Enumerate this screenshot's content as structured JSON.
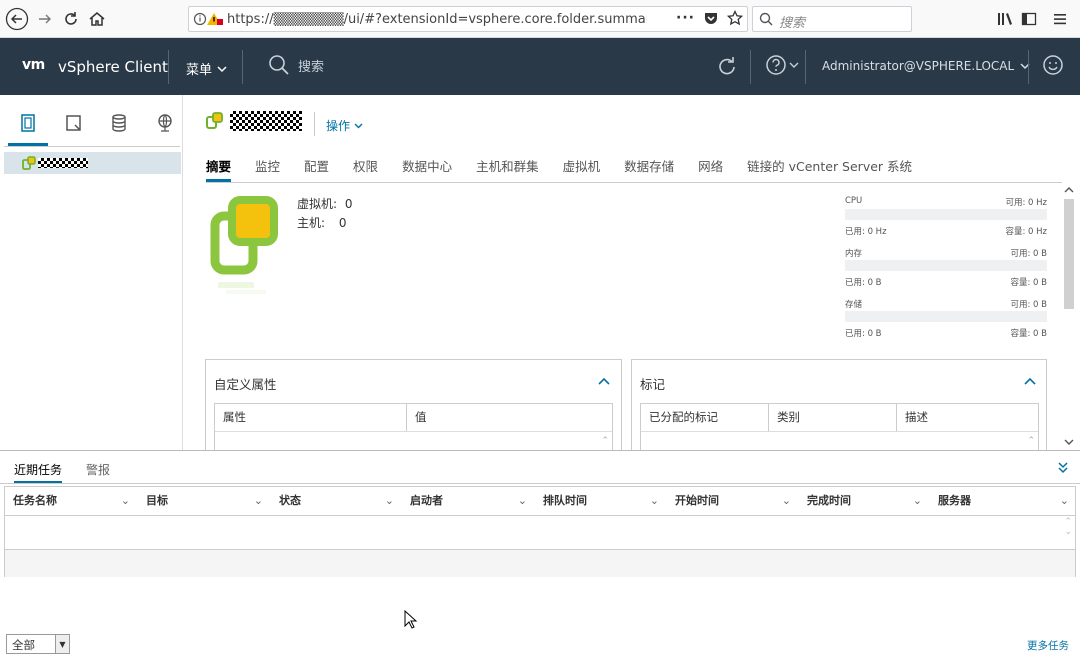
{
  "browser": {
    "url": "https://▒▒▒▒▒▒▒/ui/#?extensionId=vsphere.core.folder.summary&objectId=urn:",
    "search_placeholder": "搜索"
  },
  "header": {
    "logo": "vm",
    "title": "vSphere Client",
    "menu_label": "菜单",
    "search_placeholder": "搜索",
    "user": "Administrator@VSPHERE.LOCAL"
  },
  "object": {
    "actions_label": "操作"
  },
  "tabs": [
    {
      "label": "摘要",
      "active": true
    },
    {
      "label": "监控"
    },
    {
      "label": "配置"
    },
    {
      "label": "权限"
    },
    {
      "label": "数据中心"
    },
    {
      "label": "主机和群集"
    },
    {
      "label": "虚拟机"
    },
    {
      "label": "数据存储"
    },
    {
      "label": "网络"
    },
    {
      "label": "链接的 vCenter Server 系统"
    }
  ],
  "summary": {
    "vms_label": "虚拟机:",
    "vms_value": "0",
    "hosts_label": "主机:",
    "hosts_value": "0"
  },
  "resources": [
    {
      "name": "CPU",
      "free": "可用: 0 Hz",
      "used": "已用: 0 Hz",
      "capacity": "容量: 0 Hz",
      "usage": 0
    },
    {
      "name": "内存",
      "free": "可用: 0 B",
      "used": "已用: 0 B",
      "capacity": "容量: 0 B",
      "usage": 0
    },
    {
      "name": "存储",
      "free": "可用: 0 B",
      "used": "已用: 0 B",
      "capacity": "容量: 0 B",
      "usage": 0
    }
  ],
  "custom_attributes": {
    "title": "自定义属性",
    "columns": [
      "属性",
      "值"
    ]
  },
  "tags": {
    "title": "标记",
    "columns": [
      "已分配的标记",
      "类别",
      "描述"
    ]
  },
  "bottom": {
    "tabs": [
      "近期任务",
      "警报"
    ],
    "columns": [
      "任务名称",
      "目标",
      "状态",
      "启动者",
      "排队时间",
      "开始时间",
      "完成时间",
      "服务器"
    ],
    "filter_value": "全部",
    "more_tasks": "更多任务"
  },
  "colors": {
    "header_bg": "#2a3947",
    "accent": "#0072a3",
    "datacenter_green": "#8cc63f",
    "datacenter_yellow": "#f4c20d"
  }
}
